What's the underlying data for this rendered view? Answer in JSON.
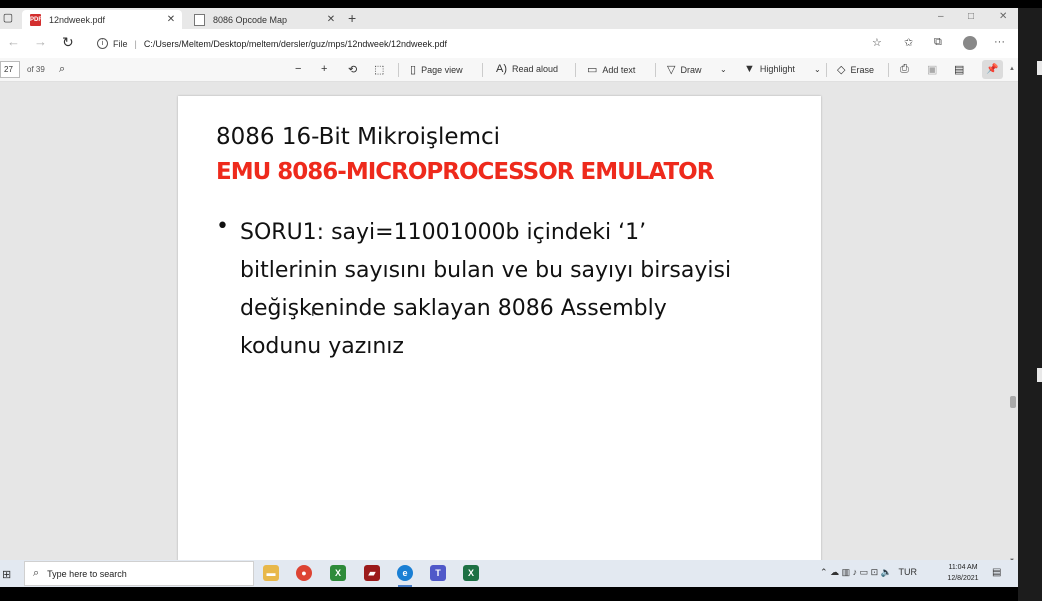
{
  "tabs": [
    {
      "label": "12ndweek.pdf",
      "close": "✕"
    },
    {
      "label": "8086 Opcode Map",
      "close": "✕"
    }
  ],
  "new_tab": "+",
  "window_controls": [
    "–",
    "□",
    "✕"
  ],
  "address": {
    "scheme_label": "File",
    "separator": "|",
    "url": "C:/Users/Meltem/Desktop/meltem/dersler/guz/mps/12ndweek/12ndweek.pdf"
  },
  "pdf_toolbar": {
    "page_number": "27",
    "page_count": "of 39",
    "page_view": "Page view",
    "read_aloud": "Read aloud",
    "add_text": "Add text",
    "draw": "Draw",
    "highlight": "Highlight",
    "erase": "Erase"
  },
  "slide": {
    "title": "8086 16-Bit Mikroişlemci",
    "subtitle": "EMU 8086-MICROPROCESSOR EMULATOR",
    "bullet_mark": "•",
    "bullet_text": "SORU1: sayi=11001000b içindeki ‘1’ bitlerinin sayısını bulan ve bu sayıyı birsayisi değişkeninde saklayan 8086 Assembly kodunu yazınız"
  },
  "taskbar": {
    "search_placeholder": "Type here to search",
    "language": "TUR",
    "time": "11:04 AM",
    "date": "12/8/2021"
  },
  "colors": {
    "subtitle_red": "#ee2a1c",
    "page_bg": "#ffffff",
    "viewer_bg": "#e6e6e6",
    "taskbar_bg": "#e3e9f1"
  }
}
